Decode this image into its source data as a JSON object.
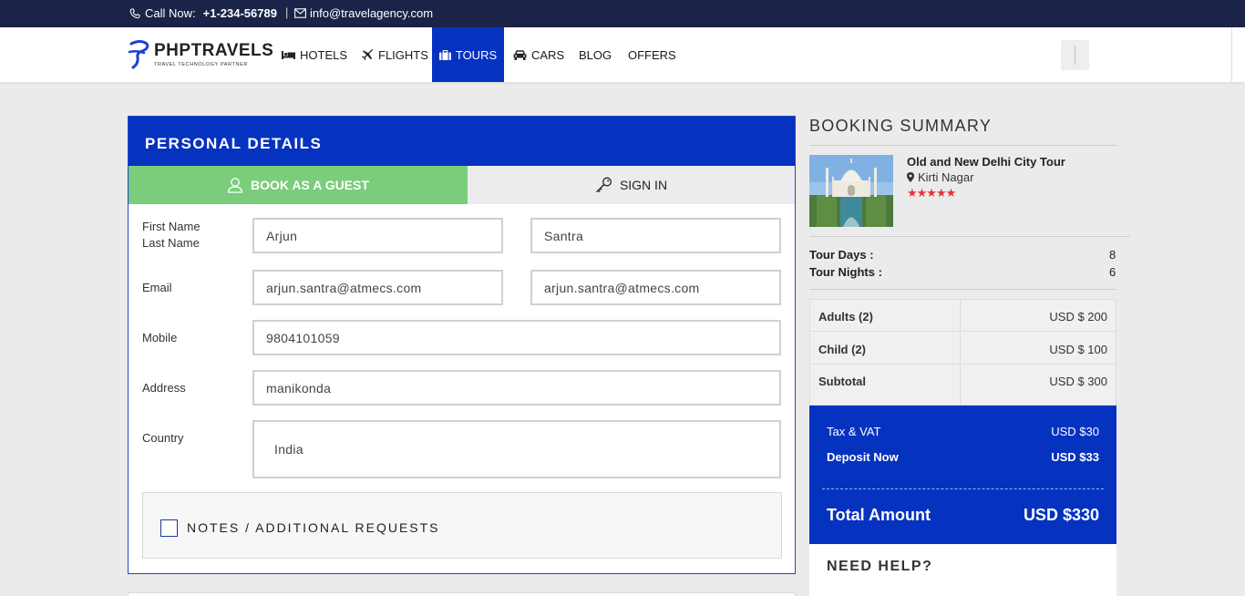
{
  "topbar": {
    "call_label": "Call Now:",
    "phone": "+1-234-56789",
    "separator": "|",
    "email": "info@travelagency.com"
  },
  "logo": {
    "name": "PHPTRAVELS",
    "tagline": "TRAVEL TECHNOLOGY PARTNER"
  },
  "nav": {
    "items": [
      {
        "label": "HOTELS",
        "icon": "bed-icon"
      },
      {
        "label": "FLIGHTS",
        "icon": "plane-icon"
      },
      {
        "label": "TOURS",
        "icon": "suitcase-icon",
        "active": true
      },
      {
        "label": "CARS",
        "icon": "car-icon"
      },
      {
        "label": "BLOG"
      },
      {
        "label": "OFFERS"
      }
    ]
  },
  "personal": {
    "title": "PERSONAL DETAILS",
    "tab_guest": "BOOK AS A GUEST",
    "tab_signin": "SIGN IN",
    "first_name_label": "First Name",
    "last_name_label": "Last Name",
    "first_name": "Arjun",
    "last_name": "Santra",
    "email_label": "Email",
    "email": "arjun.santra@atmecs.com",
    "email_confirm": "arjun.santra@atmecs.com",
    "mobile_label": "Mobile",
    "mobile": "9804101059",
    "address_label": "Address",
    "address": "manikonda",
    "country_label": "Country",
    "country": "India",
    "notes_label": "NOTES / ADDITIONAL REQUESTS"
  },
  "summary": {
    "title": "BOOKING SUMMARY",
    "tour_name": "Old and New Delhi City Tour",
    "location": "Kirti Nagar",
    "stars": "★★★★★",
    "rating": 5,
    "tour_days_label": "Tour Days :",
    "tour_days": "8",
    "tour_nights_label": "Tour Nights :",
    "tour_nights": "6",
    "rows": [
      {
        "label": "Adults (2)",
        "value": "USD $ 200"
      },
      {
        "label": "Child (2)",
        "value": "USD $ 100"
      },
      {
        "label": "Subtotal",
        "value": "USD $ 300"
      }
    ],
    "tax_label": "Tax & VAT",
    "tax_value": "USD $30",
    "deposit_label": "Deposit Now",
    "deposit_value": "USD $33",
    "total_label": "Total Amount",
    "total_value": "USD $330",
    "help_title": "NEED HELP?"
  },
  "colors": {
    "primary": "#0632c0",
    "topbar": "#1b2448",
    "guest_tab": "#7bcc7b",
    "star": "#e63333"
  }
}
